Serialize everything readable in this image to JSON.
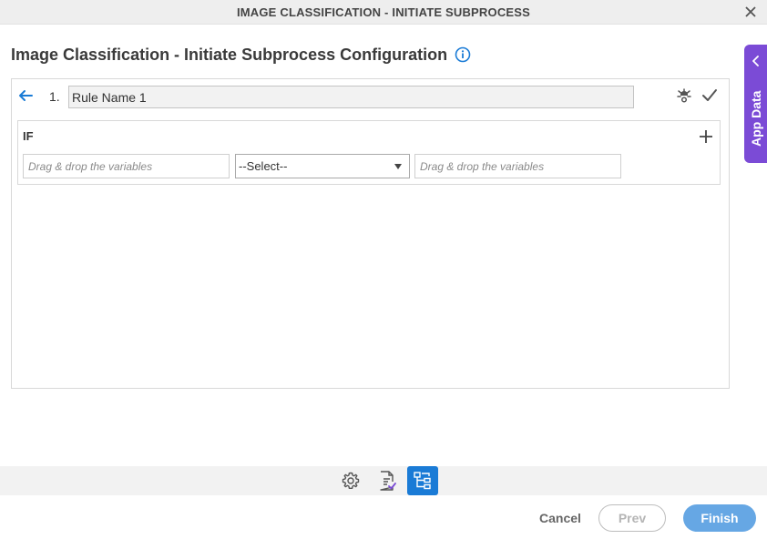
{
  "window": {
    "title": "IMAGE CLASSIFICATION - INITIATE SUBPROCESS"
  },
  "heading": {
    "text": "Image Classification - Initiate Subprocess Configuration"
  },
  "rule": {
    "number": "1.",
    "name": "Rule Name 1"
  },
  "condition": {
    "if_label": "IF",
    "left_placeholder": "Drag & drop the variables",
    "operator_selected": "--Select--",
    "right_placeholder": "Drag & drop the variables"
  },
  "side_tab": {
    "label": "App Data"
  },
  "toolbar": {
    "items": [
      "settings-icon",
      "form-check-icon",
      "rules-tree-icon"
    ],
    "active": "rules-tree-icon"
  },
  "footer": {
    "cancel_label": "Cancel",
    "prev_label": "Prev",
    "finish_label": "Finish"
  },
  "colors": {
    "accent": "#1a7bd6",
    "side_tab": "#7b4bd6",
    "finish_button": "#66a7e4"
  }
}
